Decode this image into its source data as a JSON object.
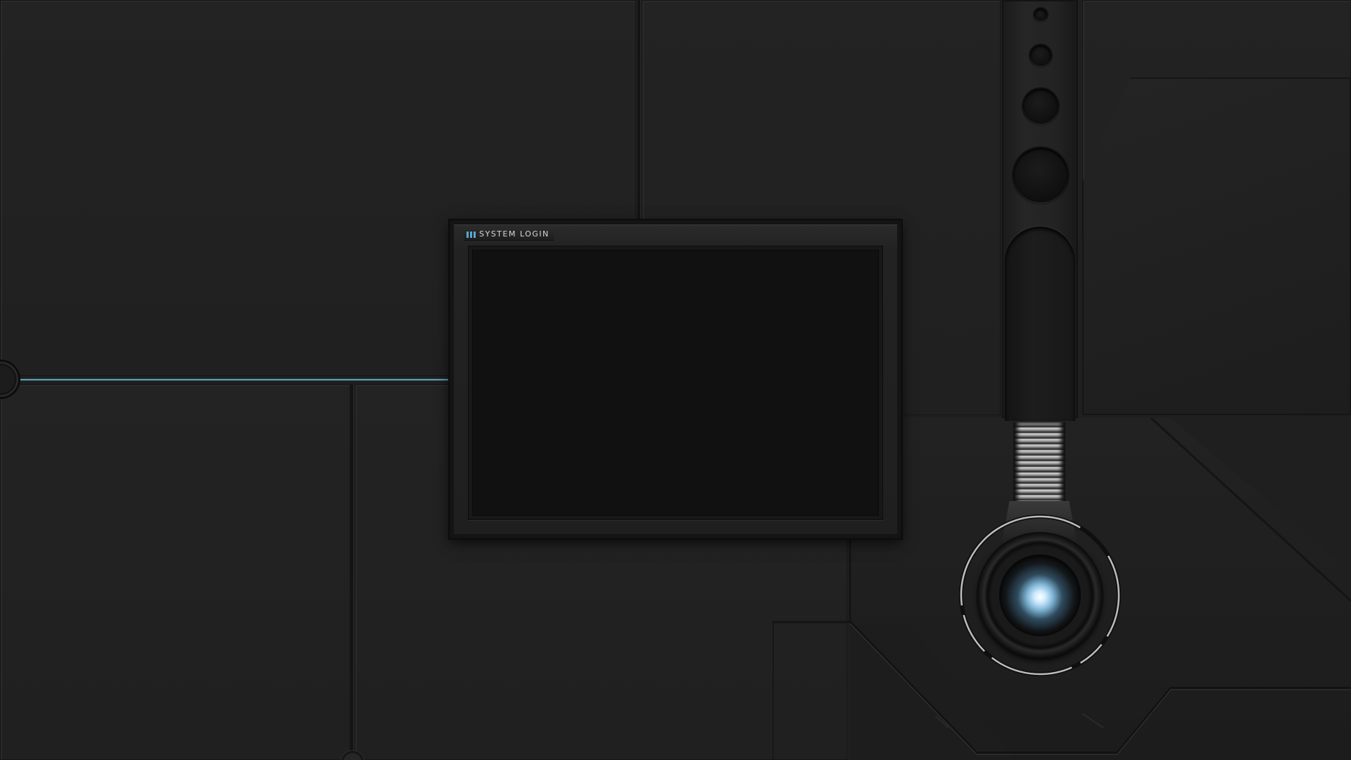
{
  "login_window": {
    "title": "SYSTEM LOGIN"
  },
  "colors": {
    "accent": "#5aa8d0",
    "connector_glow": "#a6dbe8",
    "background": "#1f1f1f",
    "screen": "#111111"
  },
  "icons": {
    "title_marker": "three-bars-icon",
    "eye": "glowing-lens-icon"
  }
}
